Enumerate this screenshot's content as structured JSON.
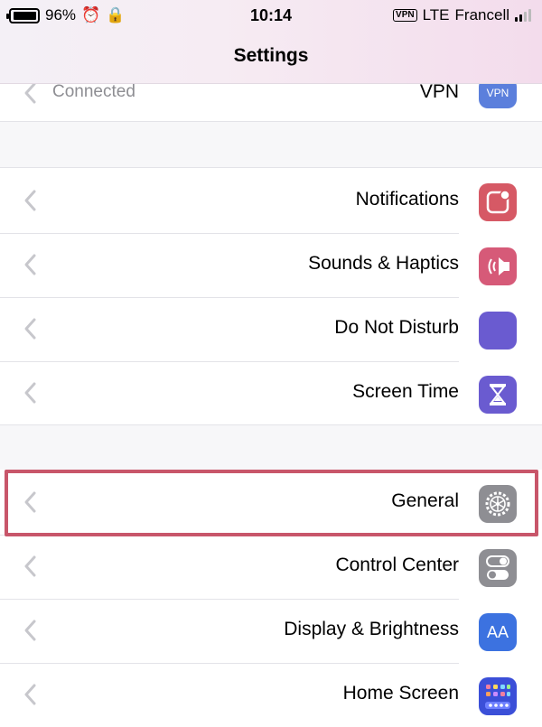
{
  "status_bar": {
    "battery_percent": "96%",
    "time": "10:14",
    "network": "LTE",
    "vpn_badge": "VPN",
    "carrier": "Francell"
  },
  "header": {
    "title": "Settings"
  },
  "vpn_row": {
    "label": "VPN",
    "value": "Connected",
    "icon_text": "VPN",
    "icon_color": "#5b7fdc"
  },
  "group1": [
    {
      "label": "Notifications",
      "icon": "notifications-icon",
      "color": "#d65965"
    },
    {
      "label": "Sounds & Haptics",
      "icon": "speaker-icon",
      "color": "#d65a78"
    },
    {
      "label": "Do Not Disturb",
      "icon": "moon-icon",
      "color": "#6a5bd0"
    },
    {
      "label": "Screen Time",
      "icon": "hourglass-icon",
      "color": "#6a5bd0"
    }
  ],
  "group2": [
    {
      "label": "General",
      "icon": "gear-icon",
      "color": "#8e8e93",
      "highlighted": true
    },
    {
      "label": "Control Center",
      "icon": "toggles-icon",
      "color": "#8e8e93"
    },
    {
      "label": "Display & Brightness",
      "icon": "aa-icon",
      "icon_text": "AA",
      "color": "#3c72e0"
    },
    {
      "label": "Home Screen",
      "icon": "home-grid-icon",
      "color": "#3b4fd8"
    }
  ],
  "colors": {
    "highlight": "#c8566a",
    "chevron": "#c7c7cc"
  }
}
